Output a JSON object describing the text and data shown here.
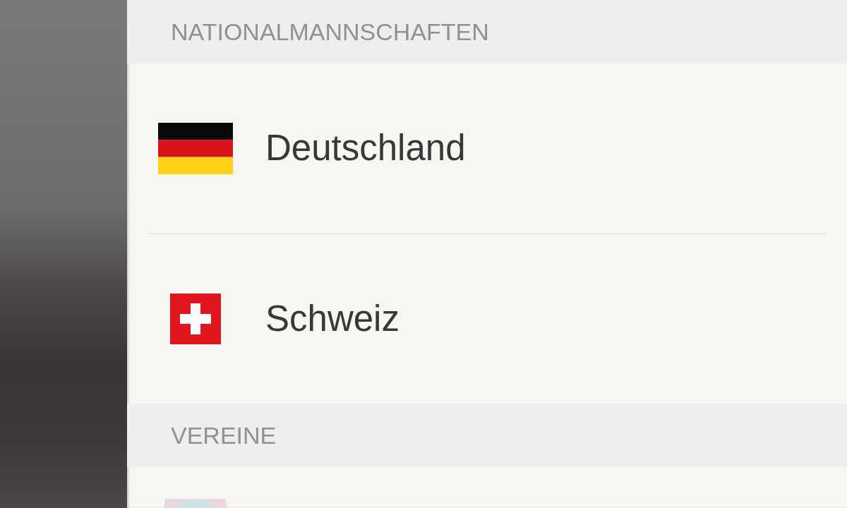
{
  "sections": [
    {
      "title": "NATIONALMANNSCHAFTEN",
      "items": [
        {
          "kind": "germany",
          "name": "Deutschland"
        },
        {
          "kind": "switzerland",
          "name": "Schweiz"
        }
      ]
    },
    {
      "title": "VEREINE",
      "items": [
        {
          "kind": "emblem"
        }
      ]
    }
  ]
}
